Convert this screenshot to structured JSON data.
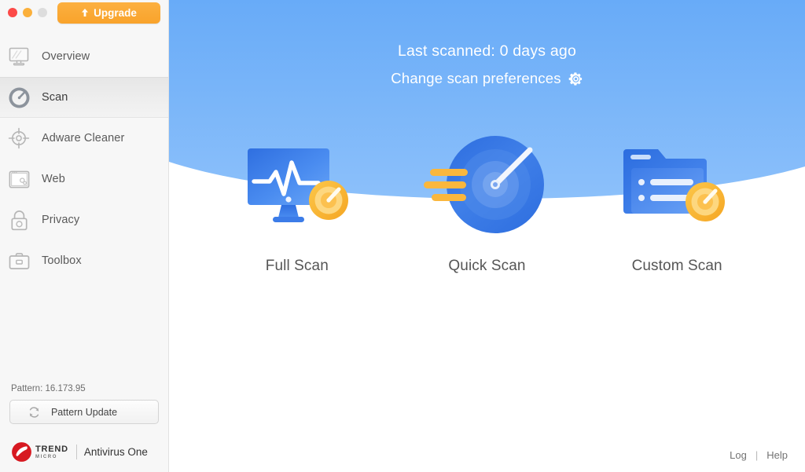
{
  "window": {
    "traffic_lights": [
      {
        "name": "close",
        "color": "#fc4a48"
      },
      {
        "name": "minimize",
        "color": "#fbb03b"
      },
      {
        "name": "zoom",
        "color": "#dddddd"
      }
    ],
    "upgrade_label": "Upgrade"
  },
  "sidebar": {
    "items": [
      {
        "label": "Overview",
        "icon": "monitor-icon",
        "active": false
      },
      {
        "label": "Scan",
        "icon": "gauge-icon",
        "active": true
      },
      {
        "label": "Adware Cleaner",
        "icon": "crosshair-icon",
        "active": false
      },
      {
        "label": "Web",
        "icon": "browser-icon",
        "active": false
      },
      {
        "label": "Privacy",
        "icon": "lock-icon",
        "active": false
      },
      {
        "label": "Toolbox",
        "icon": "briefcase-icon",
        "active": false
      }
    ],
    "pattern_version": "Pattern: 16.173.95",
    "pattern_update_label": "Pattern Update",
    "brand": {
      "line1": "TREND",
      "line2": "MICRO",
      "product": "Antivirus One"
    }
  },
  "header": {
    "last_scanned": "Last scanned: 0 days ago",
    "preferences_label": "Change scan preferences"
  },
  "scan_options": [
    {
      "label": "Full Scan",
      "icon": "monitor-pulse-icon"
    },
    {
      "label": "Quick Scan",
      "icon": "radar-icon"
    },
    {
      "label": "Custom Scan",
      "icon": "folder-list-icon"
    }
  ],
  "footer": {
    "log_label": "Log",
    "separator": "|",
    "help_label": "Help"
  },
  "colors": {
    "hero_blue": "#62a8f7",
    "accent_orange": "#f9a32b",
    "brand_red": "#d71921",
    "sidebar_bg": "#f7f7f7"
  }
}
